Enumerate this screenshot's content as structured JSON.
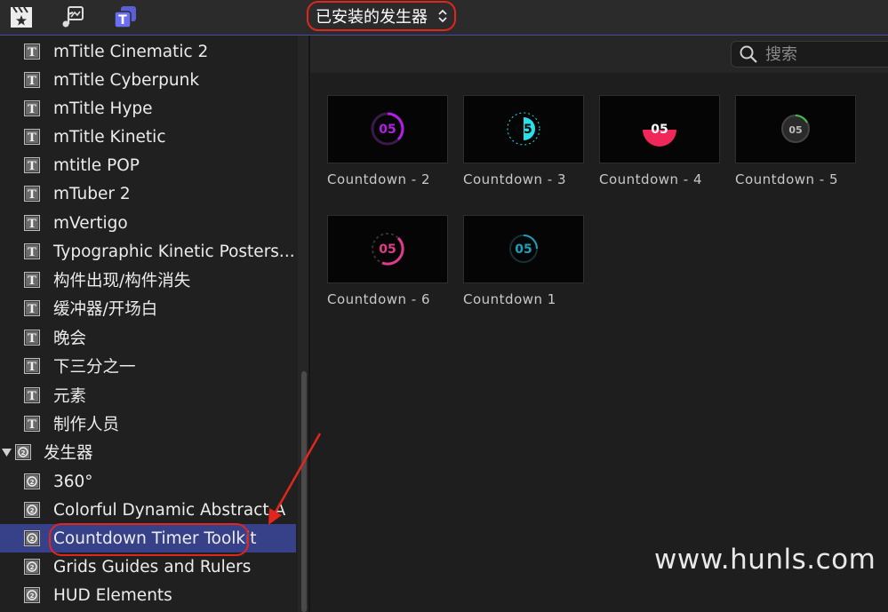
{
  "toolbar": {
    "icons": [
      "clapper-icon",
      "music-photo-icon",
      "titles-generators-icon"
    ],
    "library_select": {
      "label": "已安装的发生器",
      "icon": "chevron-updown-icon"
    }
  },
  "search": {
    "placeholder": "搜索",
    "icon": "search-icon"
  },
  "sidebar": {
    "items": [
      {
        "label": "mTitle Cinematic 2",
        "icon": "title-t-icon"
      },
      {
        "label": "mTitle Cyberpunk",
        "icon": "title-t-icon"
      },
      {
        "label": "mTitle Hype",
        "icon": "title-t-icon"
      },
      {
        "label": "mTitle Kinetic",
        "icon": "title-t-icon"
      },
      {
        "label": "mtitle POP",
        "icon": "title-t-icon"
      },
      {
        "label": "mTuber 2",
        "icon": "title-t-icon"
      },
      {
        "label": "mVertigo",
        "icon": "title-t-icon"
      },
      {
        "label": "Typographic Kinetic Posters...",
        "icon": "title-t-icon"
      },
      {
        "label": "构件出现/构件消失",
        "icon": "title-t-icon"
      },
      {
        "label": "缓冲器/开场白",
        "icon": "title-t-icon"
      },
      {
        "label": "晚会",
        "icon": "title-t-icon"
      },
      {
        "label": "下三分之一",
        "icon": "title-t-icon"
      },
      {
        "label": "元素",
        "icon": "title-t-icon"
      },
      {
        "label": "制作人员",
        "icon": "title-t-icon"
      },
      {
        "label": "发生器",
        "icon": "generator-icon",
        "group": true,
        "expanded": true
      },
      {
        "label": "360°",
        "icon": "generator-icon"
      },
      {
        "label": "Colorful Dynamic Abstract A",
        "icon": "generator-icon"
      },
      {
        "label": "Countdown Timer Toolkit",
        "icon": "generator-icon",
        "selected": true
      },
      {
        "label": "Grids Guides and Rulers",
        "icon": "generator-icon"
      },
      {
        "label": "HUD Elements",
        "icon": "generator-icon"
      }
    ]
  },
  "browser": {
    "tiles": [
      {
        "label": "Countdown - 2",
        "number": "05",
        "accent": "#b41ee6"
      },
      {
        "label": "Countdown - 3",
        "number": "05",
        "accent": "#28e0e8"
      },
      {
        "label": "Countdown - 4",
        "number": "05",
        "accent": "#f0285a"
      },
      {
        "label": "Countdown - 5",
        "number": "05",
        "accent": "#3fbf4a"
      },
      {
        "label": "Countdown - 6",
        "number": "05",
        "accent": "#e23a8c"
      },
      {
        "label": "Countdown 1",
        "number": "05",
        "accent": "#1aa0b8"
      }
    ]
  },
  "watermark": "www.hunls.com",
  "colors": {
    "selection": "#37418a",
    "annotation": "#e0261d"
  }
}
